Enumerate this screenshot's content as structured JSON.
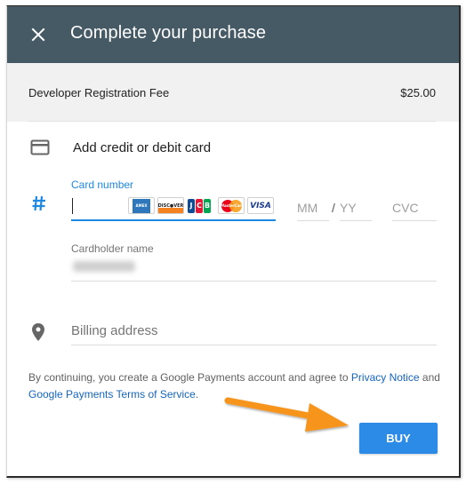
{
  "header": {
    "title": "Complete your purchase",
    "close_icon": "close-icon"
  },
  "order": {
    "item_label": "Developer Registration Fee",
    "amount": "$25.00"
  },
  "card_section": {
    "title": "Add credit or debit card",
    "icon": "credit-card-icon",
    "card_number": {
      "label": "Card number",
      "value": "",
      "icon": "hash-icon",
      "brands": [
        "American Express",
        "Discover",
        "JCB",
        "MasterCard",
        "VISA"
      ]
    },
    "expiry_month": {
      "placeholder": "MM"
    },
    "expiry_separator": "/",
    "expiry_year": {
      "placeholder": "YY"
    },
    "cvc": {
      "placeholder": "CVC"
    },
    "cardholder_name": {
      "label": "Cardholder name",
      "value_state": "blurred"
    }
  },
  "billing": {
    "placeholder": "Billing address",
    "icon": "location-pin-icon"
  },
  "terms": {
    "text_before": "By continuing, you create a Google Payments account and agree to ",
    "privacy_link": "Privacy Notice",
    "text_middle": " and ",
    "tos_link": "Google Payments Terms of Service",
    "text_after": "."
  },
  "actions": {
    "buy_label": "BUY"
  },
  "annotation": {
    "arrow_color": "#f7941d",
    "points_to": "buy-button"
  },
  "colors": {
    "header_bg": "#455a64",
    "accent": "#1e88e5",
    "buy_bg": "#2c8be6",
    "link": "#1565c0"
  }
}
